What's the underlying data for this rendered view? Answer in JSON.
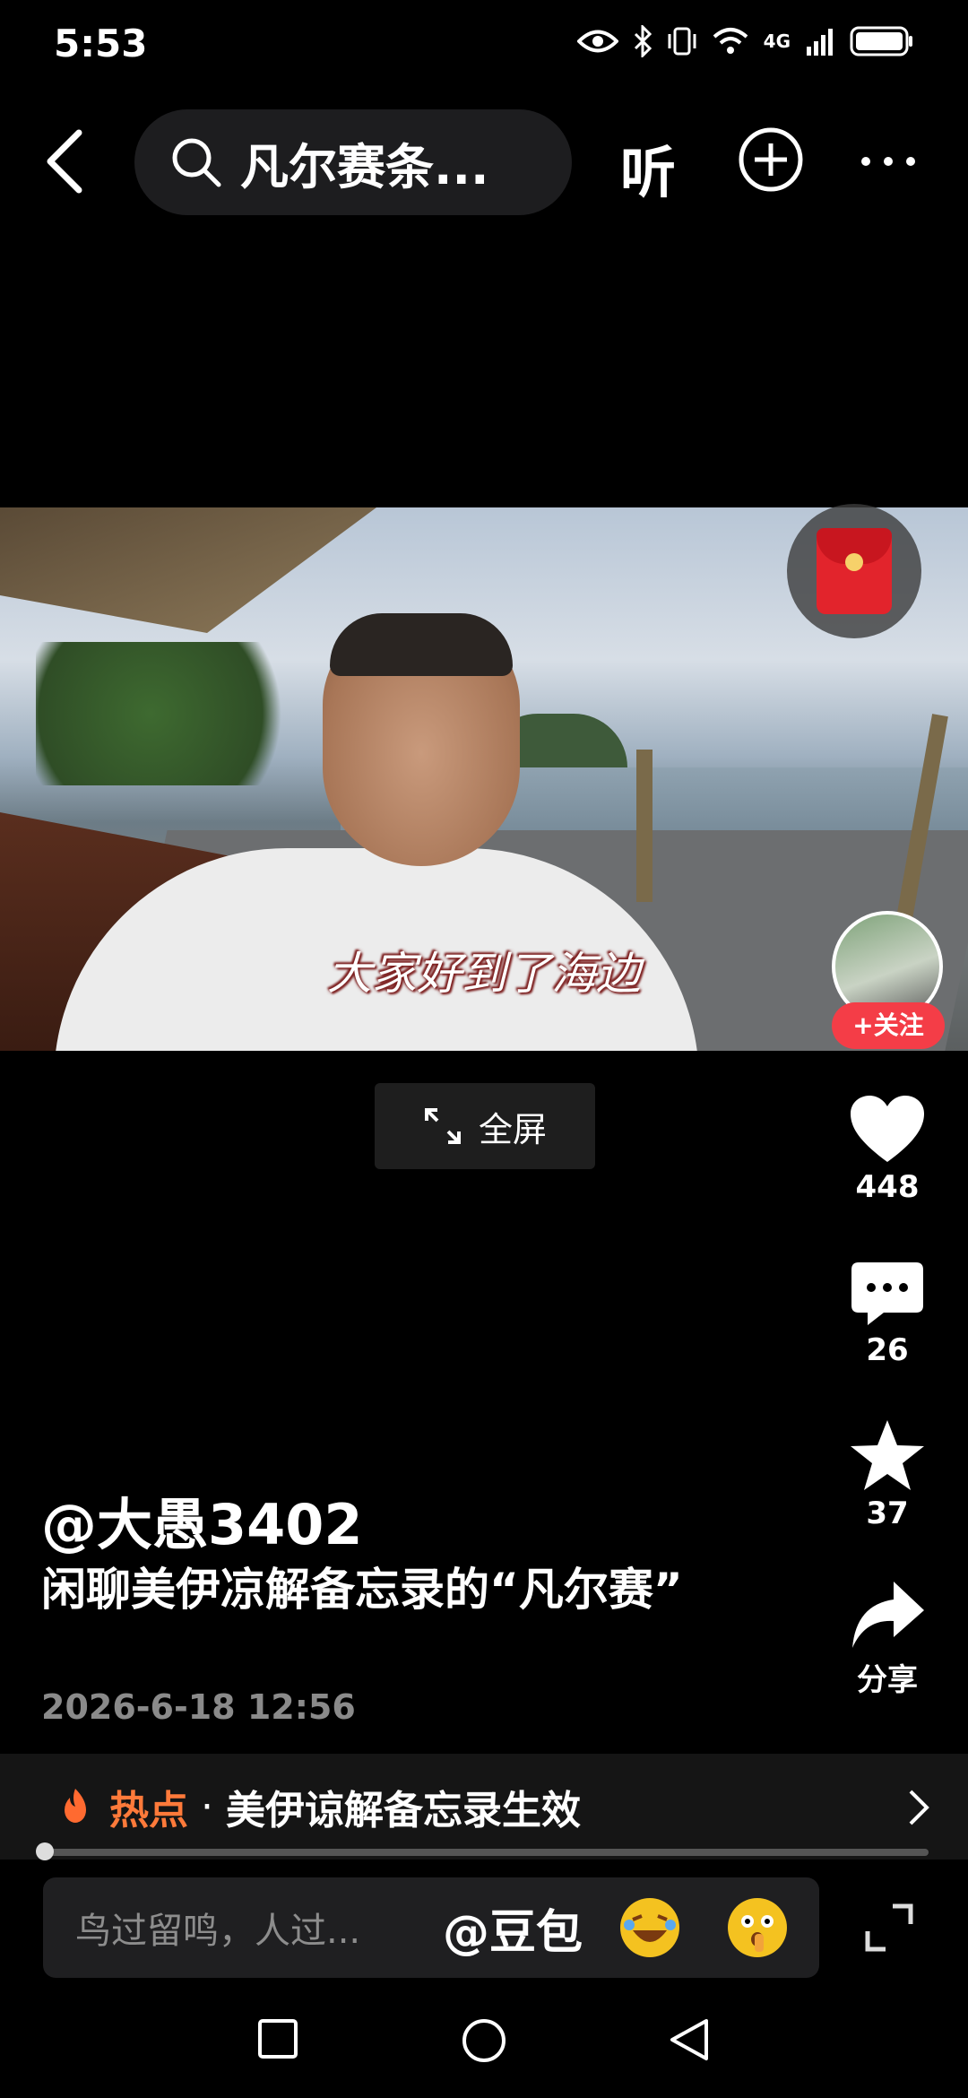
{
  "status_bar": {
    "time": "5:53",
    "network": "4G"
  },
  "topnav": {
    "search_text": "凡尔赛条...",
    "listen_label": "听"
  },
  "video": {
    "subtitle": "大家好到了海边",
    "follow_label": "+关注",
    "fullscreen_label": "全屏"
  },
  "actions": {
    "like_count": "448",
    "comment_count": "26",
    "favorite_count": "37",
    "share_label": "分享"
  },
  "post": {
    "author": "@大愚3402",
    "title": "闲聊美伊凉解备忘录的“凡尔赛”",
    "date": "2026-6-18 12:56"
  },
  "hot": {
    "label": "热点",
    "separator": "·",
    "text": "美伊谅解备忘录生效"
  },
  "comment_bar": {
    "placeholder": "鸟过留鸣，人过...",
    "mention": "@豆包"
  },
  "colors": {
    "accent_red": "#f43d47",
    "hot_orange": "#ff7a3a",
    "background": "#000000"
  },
  "icons": [
    "back-icon",
    "search-icon",
    "plus-circle-icon",
    "more-icon",
    "red-packet-icon",
    "expand-icon",
    "heart-icon",
    "comment-icon",
    "star-icon",
    "share-icon",
    "fire-icon",
    "chevron-right-icon",
    "laugh-emoji-icon",
    "shush-emoji-icon",
    "recent-apps-icon",
    "home-icon",
    "back-nav-icon"
  ]
}
